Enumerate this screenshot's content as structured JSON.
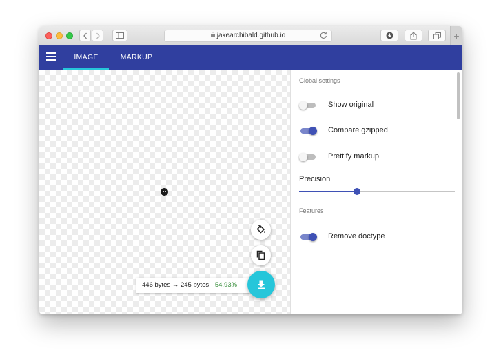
{
  "browser": {
    "url": "jakearchibald.github.io",
    "new_tab_symbol": "+"
  },
  "appbar": {
    "tabs": [
      {
        "label": "IMAGE",
        "active": true
      },
      {
        "label": "MARKUP",
        "active": false
      }
    ],
    "accent_color": "#303f9f",
    "indicator_color": "#26c6da"
  },
  "results": {
    "original": "446 bytes",
    "arrow": "→",
    "optimized": "245 bytes",
    "percent": "54.93%"
  },
  "settings": {
    "global_label": "Global settings",
    "toggles": [
      {
        "label": "Show original",
        "on": false
      },
      {
        "label": "Compare gzipped",
        "on": true
      },
      {
        "label": "Prettify markup",
        "on": false
      }
    ],
    "precision_label": "Precision",
    "precision_value_fraction": 0.37,
    "features_label": "Features",
    "features": [
      {
        "label": "Remove doctype",
        "on": true
      }
    ]
  },
  "icons": {
    "menu": "hamburger-menu-icon",
    "paint": "paint-bucket-icon",
    "copy": "copy-icon",
    "download": "download-icon"
  }
}
